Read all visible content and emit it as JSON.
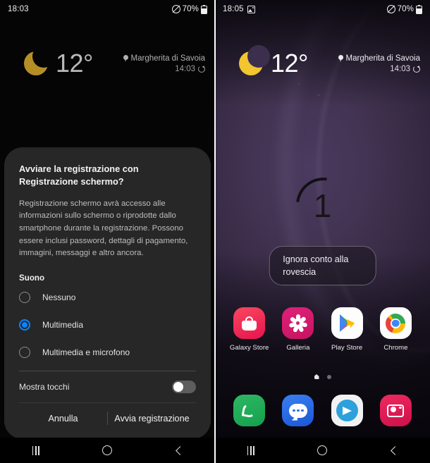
{
  "left_phone": {
    "status_bar": {
      "time": "18:03",
      "battery_pct": "70%",
      "icons": [
        "mute-icon",
        "battery-icon"
      ]
    },
    "weather": {
      "icon": "moon-icon",
      "temperature": "12°",
      "location": "Margherita di Savoia",
      "location_icon": "location-pin-icon",
      "updated_time": "14:03",
      "refresh_icon": "refresh-icon"
    },
    "dialog": {
      "title": "Avviare la registrazione con Registrazione schermo?",
      "body": "Registrazione schermo avrà accesso alle informazioni sullo schermo o riprodotte dallo smartphone durante la registrazione. Possono essere inclusi password, dettagli di pagamento, immagini, messaggi e altro ancora.",
      "section_label": "Suono",
      "options": [
        {
          "label": "Nessuno",
          "selected": false
        },
        {
          "label": "Multimedia",
          "selected": true
        },
        {
          "label": "Multimedia e microfono",
          "selected": false
        }
      ],
      "toggle_label": "Mostra tocchi",
      "toggle_on": false,
      "cancel_label": "Annulla",
      "confirm_label": "Avvia registrazione",
      "accent_color": "#0a84ff",
      "background_color": "#272727"
    },
    "nav_bar": {
      "recents": "recents-icon",
      "home": "home-icon",
      "back": "back-icon"
    }
  },
  "right_phone": {
    "status_bar": {
      "time": "18:05",
      "battery_pct": "70%",
      "icons": [
        "screenshot-icon",
        "mute-icon",
        "battery-icon"
      ]
    },
    "weather": {
      "icon": "moon-icon",
      "temperature": "12°",
      "location": "Margherita di Savoia",
      "location_icon": "location-pin-icon",
      "updated_time": "14:03",
      "refresh_icon": "refresh-icon"
    },
    "countdown": {
      "value": "1",
      "skip_label": "Ignora conto alla rovescia"
    },
    "apps": [
      {
        "label": "Galaxy Store",
        "icon": "shopping-bag-icon",
        "color": "#f0325b"
      },
      {
        "label": "Galleria",
        "icon": "flower-icon",
        "color": "#d21f6d"
      },
      {
        "label": "Play Store",
        "icon": "play-store-icon",
        "color": "#ffffff"
      },
      {
        "label": "Chrome",
        "icon": "chrome-icon",
        "color": "#ffffff"
      }
    ],
    "page_indicator": {
      "pages": 2,
      "current": 1
    },
    "dock": [
      {
        "name": "Telefono",
        "icon": "phone-icon",
        "color": "#16a34a"
      },
      {
        "name": "Messaggi",
        "icon": "message-bubble-icon",
        "color": "#2563eb"
      },
      {
        "name": "Telegram",
        "icon": "telegram-icon",
        "color": "#f4f4f4"
      },
      {
        "name": "Fotocamera",
        "icon": "camera-icon",
        "color": "#e01e5a"
      }
    ],
    "nav_bar": {
      "recents": "recents-icon",
      "home": "home-icon",
      "back": "back-icon"
    }
  }
}
